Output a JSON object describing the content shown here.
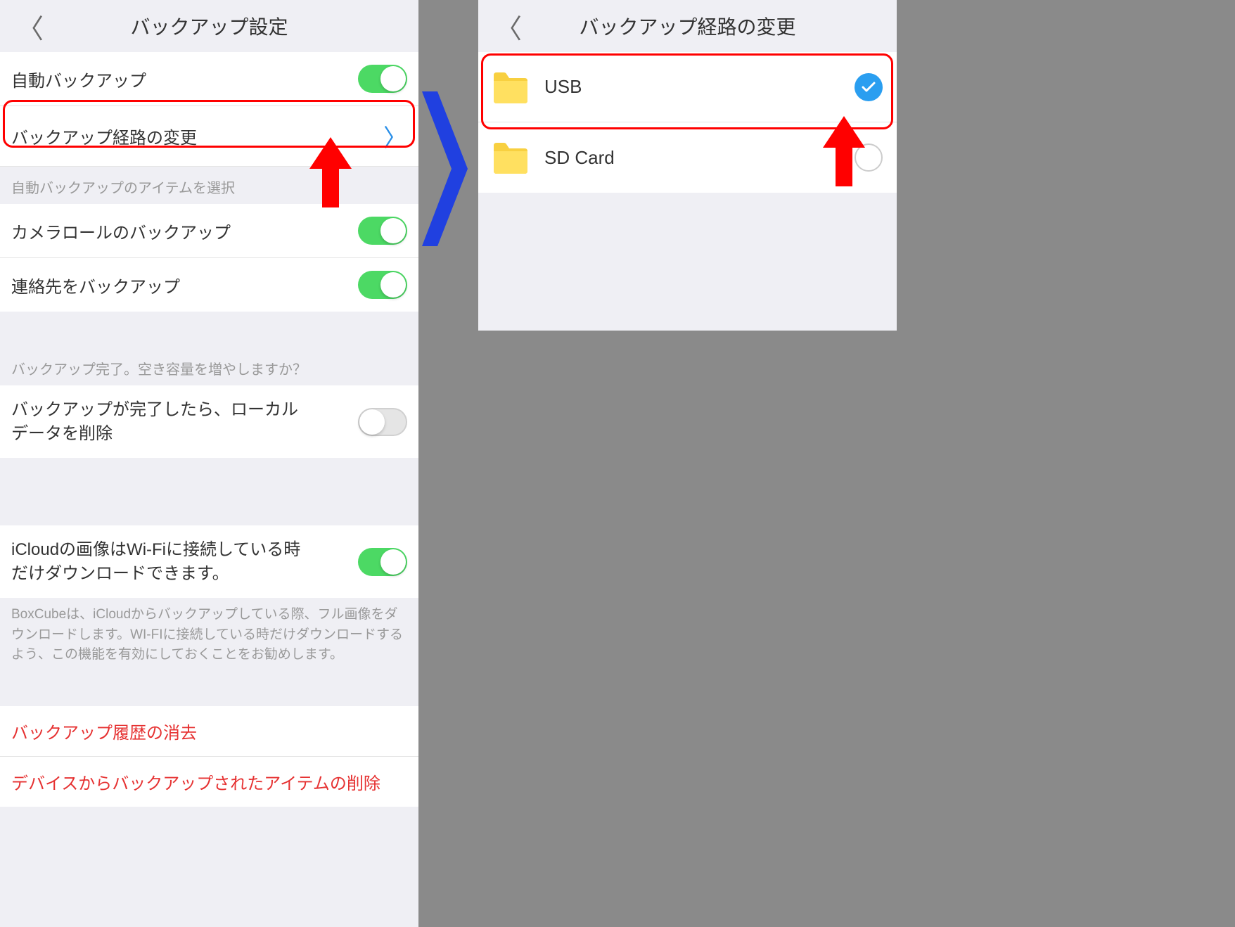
{
  "left": {
    "title": "バックアップ設定",
    "rows": {
      "auto_backup": "自動バックアップ",
      "change_path": "バックアップ経路の変更",
      "section_items": "自動バックアップのアイテムを選択",
      "camera_roll": "カメラロールのバックアップ",
      "contacts": "連絡先をバックアップ",
      "section_space": "バックアップ完了。空き容量を増やしますか？",
      "delete_after": "バックアップが完了したら、ローカルデータを削除",
      "icloud_wifi": "iCloudの画像はWi-Fiに接続している時だけダウンロードできます。",
      "icloud_desc": "BoxCubeは、iCloudからバックアップしている際、フル画像をダウンロードします。WI-FIに接続している時だけダウンロードするよう、この機能を有効にしておくことをお勧めします。",
      "clear_history": "バックアップ履歴の消去",
      "delete_backed": "デバイスからバックアップされたアイテムの削除"
    }
  },
  "right": {
    "title": "バックアップ経路の変更",
    "items": {
      "usb": "USB",
      "sdcard": "SD Card"
    }
  }
}
